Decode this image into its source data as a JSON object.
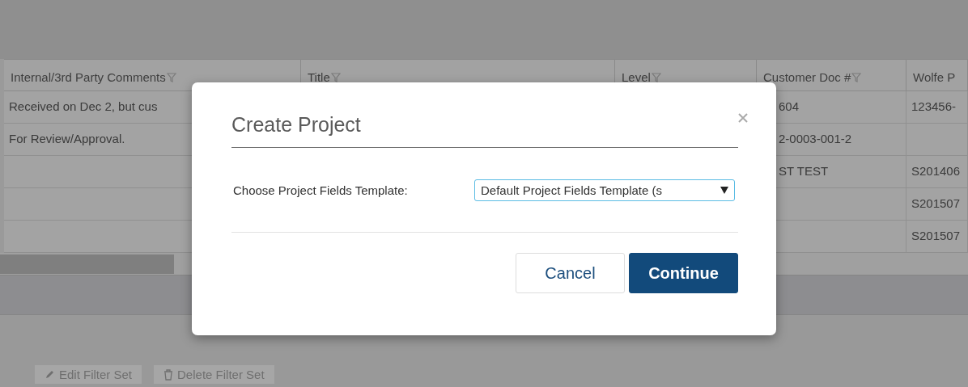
{
  "table": {
    "columns": [
      {
        "label": "Internal/3rd Party Comments",
        "filter": true
      },
      {
        "label": "Title",
        "filter": true
      },
      {
        "label": "Level",
        "filter": true
      },
      {
        "label": "Customer Doc #",
        "filter": true
      },
      {
        "label": "Wolfe P",
        "filter": false
      }
    ],
    "rows": [
      [
        "Received on Dec 2, but cus",
        "",
        "",
        "604",
        "123456-"
      ],
      [
        "For Review/Approval.",
        "",
        "",
        "2-0003-001-2",
        ""
      ],
      [
        "",
        "",
        "",
        "ST TEST",
        "S201406"
      ],
      [
        "",
        "",
        "",
        "",
        "S201507"
      ],
      [
        "",
        "",
        "",
        "",
        "S201507"
      ]
    ]
  },
  "filter_buttons": [
    {
      "label": "Edit Filter Set",
      "kind": "edit"
    },
    {
      "label": "Delete Filter Set",
      "kind": "delete"
    }
  ],
  "dialog": {
    "title": "Create Project",
    "field_label": "Choose Project Fields Template:",
    "select_value": "Default Project Fields Template (s",
    "buttons": [
      {
        "label": "Cancel",
        "kind": "secondary"
      },
      {
        "label": "Continue",
        "kind": "primary"
      }
    ]
  }
}
